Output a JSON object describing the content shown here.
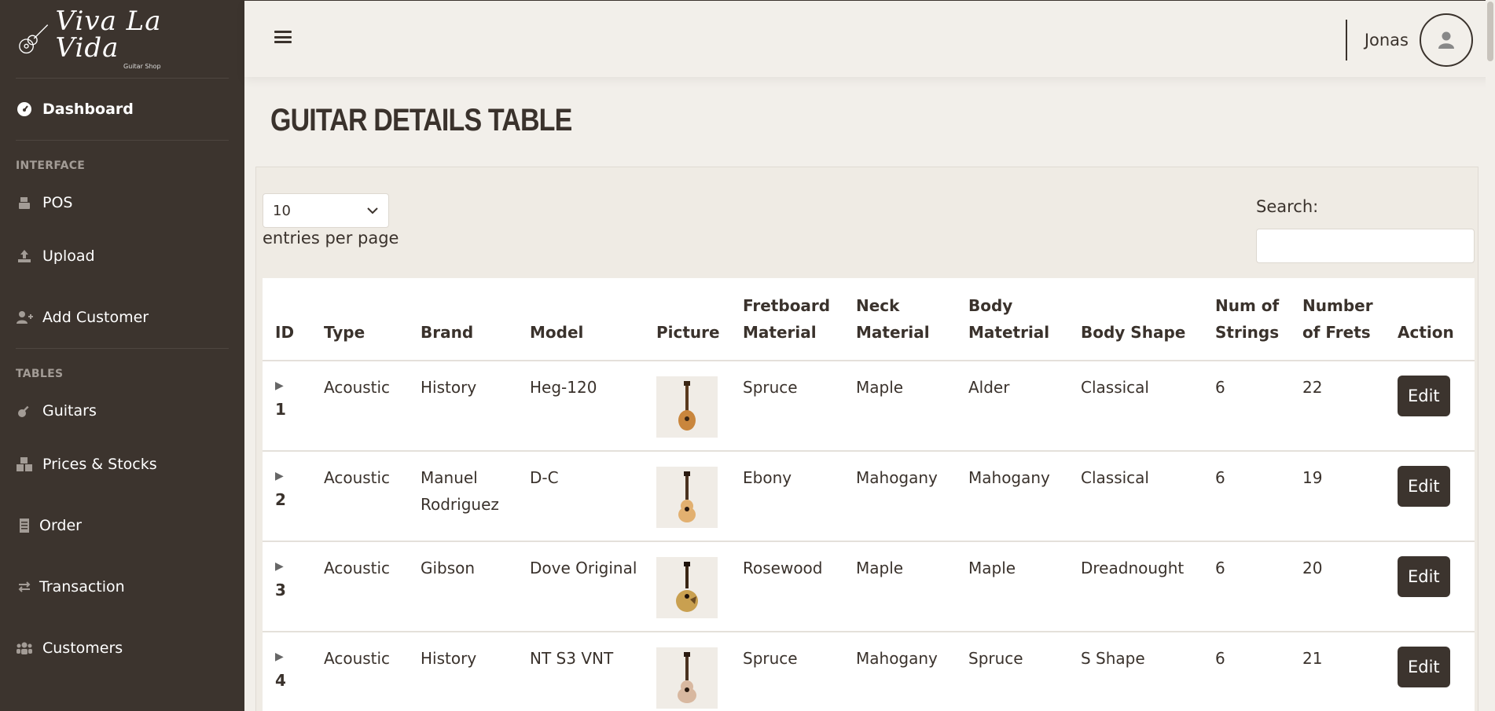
{
  "brand": {
    "name": "Viva La Vida",
    "sub": "Guitar Shop"
  },
  "sidebar": {
    "dashboard": "Dashboard",
    "heading_interface": "INTERFACE",
    "items_interface": [
      {
        "label": "POS"
      },
      {
        "label": "Upload"
      },
      {
        "label": "Add Customer"
      }
    ],
    "heading_tables": "TABLES",
    "items_tables": [
      {
        "label": "Guitars"
      },
      {
        "label": "Prices & Stocks"
      },
      {
        "label": "Order"
      },
      {
        "label": "Transaction"
      },
      {
        "label": "Customers"
      }
    ]
  },
  "topbar": {
    "username": "Jonas"
  },
  "page": {
    "title": "GUITAR DETAILS TABLE"
  },
  "table_controls": {
    "entries_value": "10",
    "entries_label": "entries per page",
    "search_label": "Search:"
  },
  "table": {
    "headers": [
      "ID",
      "Type",
      "Brand",
      "Model",
      "Picture",
      "Fretboard Material",
      "Neck Material",
      "Body Matetrial",
      "Body Shape",
      "Num of Strings",
      "Number of Frets",
      "Action"
    ],
    "rows": [
      {
        "id": "1",
        "type": "Acoustic",
        "brand": "History",
        "model": "Heg-120",
        "fretboard": "Spruce",
        "neck": "Maple",
        "body": "Alder",
        "shape": "Classical",
        "strings": "6",
        "frets": "22",
        "action": "Edit"
      },
      {
        "id": "2",
        "type": "Acoustic",
        "brand": "Manuel Rodriguez",
        "model": "D-C",
        "fretboard": "Ebony",
        "neck": "Mahogany",
        "body": "Mahogany",
        "shape": "Classical",
        "strings": "6",
        "frets": "19",
        "action": "Edit"
      },
      {
        "id": "3",
        "type": "Acoustic",
        "brand": "Gibson",
        "model": "Dove Original",
        "fretboard": "Rosewood",
        "neck": "Maple",
        "body": "Maple",
        "shape": "Dreadnought",
        "strings": "6",
        "frets": "20",
        "action": "Edit"
      },
      {
        "id": "4",
        "type": "Acoustic",
        "brand": "History",
        "model": "NT S3 VNT",
        "fretboard": "Spruce",
        "neck": "Mahogany",
        "body": "Spruce",
        "shape": "S Shape",
        "strings": "6",
        "frets": "21",
        "action": "Edit"
      }
    ]
  },
  "colors": {
    "sidebar_bg": "#3c342e",
    "page_bg": "#f2efea",
    "accent": "#3c342e"
  }
}
